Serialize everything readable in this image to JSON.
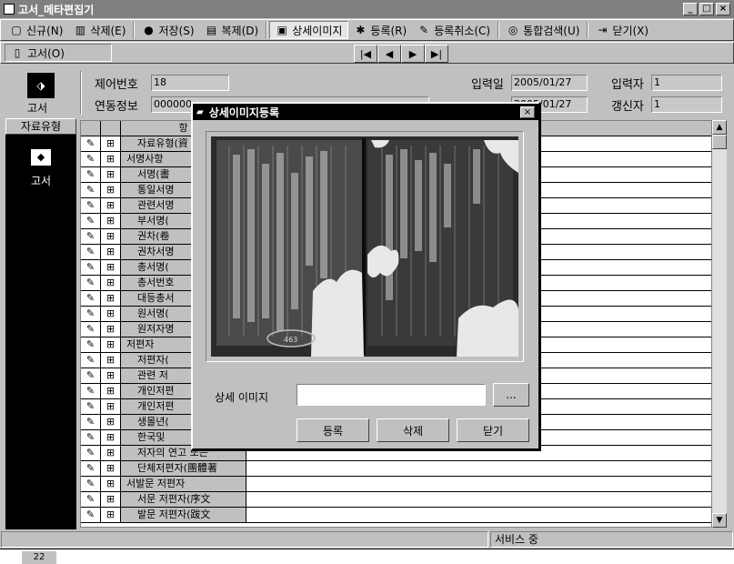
{
  "window": {
    "title": "고서_메타편집기",
    "controls": [
      "_",
      "□",
      "×"
    ]
  },
  "toolbar1": [
    {
      "label": "신규(N)",
      "icon": "new-doc-icon",
      "glyph": "▢"
    },
    {
      "label": "삭제(E)",
      "icon": "trash-icon",
      "glyph": "🗑"
    },
    {
      "label": "저장(S)",
      "icon": "save-icon",
      "glyph": "●"
    },
    {
      "label": "복제(D)",
      "icon": "copy-icon",
      "glyph": "▤"
    },
    {
      "label": "상세이미지",
      "icon": "image-icon",
      "glyph": "▣"
    },
    {
      "label": "등록(R)",
      "icon": "register-icon",
      "glyph": "✱"
    },
    {
      "label": "등록취소(C)",
      "icon": "cancel-register-icon",
      "glyph": "✎"
    },
    {
      "label": "통합검색(U)",
      "icon": "search-icon",
      "glyph": "◎"
    },
    {
      "label": "닫기(X)",
      "icon": "close-door-icon",
      "glyph": "⇥"
    }
  ],
  "toolbar2": {
    "tab_label": "고서(O)",
    "nav": [
      "|◀",
      "◀",
      "▶",
      "▶|"
    ]
  },
  "record": {
    "control_no_label": "제어번호",
    "control_no": "18",
    "link_label": "연동정보",
    "link_value": "000000",
    "input_date_label": "입력일",
    "input_date": "2005/01/27",
    "inputter_label": "입력자",
    "inputter": "1",
    "update_date": "2005/01/27",
    "updater_label": "갱신자",
    "updater": "1",
    "left_icon_label": "고서"
  },
  "left_panel": {
    "header": "자료유형",
    "item": "고서"
  },
  "grid": {
    "header": "항",
    "rows": [
      {
        "indent": 1,
        "text": "자료유형(資"
      },
      {
        "indent": 0,
        "text": "서명사항"
      },
      {
        "indent": 1,
        "text": "서명(書"
      },
      {
        "indent": 1,
        "text": "통일서명"
      },
      {
        "indent": 1,
        "text": "관련서명"
      },
      {
        "indent": 1,
        "text": "부서명("
      },
      {
        "indent": 1,
        "text": "권차(卷"
      },
      {
        "indent": 1,
        "text": "권차서명"
      },
      {
        "indent": 1,
        "text": "총서명("
      },
      {
        "indent": 1,
        "text": "총서번호"
      },
      {
        "indent": 1,
        "text": "대등총서"
      },
      {
        "indent": 1,
        "text": "원서명("
      },
      {
        "indent": 1,
        "text": "원저자명"
      },
      {
        "indent": 0,
        "text": "저편자"
      },
      {
        "indent": 1,
        "text": "저편자("
      },
      {
        "indent": 1,
        "text": "관련 저"
      },
      {
        "indent": 1,
        "text": "개인저편"
      },
      {
        "indent": 1,
        "text": "개인저편"
      },
      {
        "indent": 1,
        "text": "생몰년("
      },
      {
        "indent": 1,
        "text": "한국및"
      },
      {
        "indent": 1,
        "text": "저자의 연고 또는"
      },
      {
        "indent": 1,
        "text": "단체저편자(團體著"
      },
      {
        "indent": 0,
        "text": "서발문 저편자"
      },
      {
        "indent": 1,
        "text": "서문 저편자(序文"
      },
      {
        "indent": 1,
        "text": "발문 저편자(跋文"
      }
    ]
  },
  "status": {
    "left": "",
    "right": "서비스 중"
  },
  "bottom_row_no": "22",
  "dialog": {
    "title": "상세이미지등록",
    "field_label": "상세 이미지",
    "field_value": "",
    "browse_label": "...",
    "register_label": "등록",
    "delete_label": "삭제",
    "close_label": "닫기",
    "image_stamp": "463"
  }
}
